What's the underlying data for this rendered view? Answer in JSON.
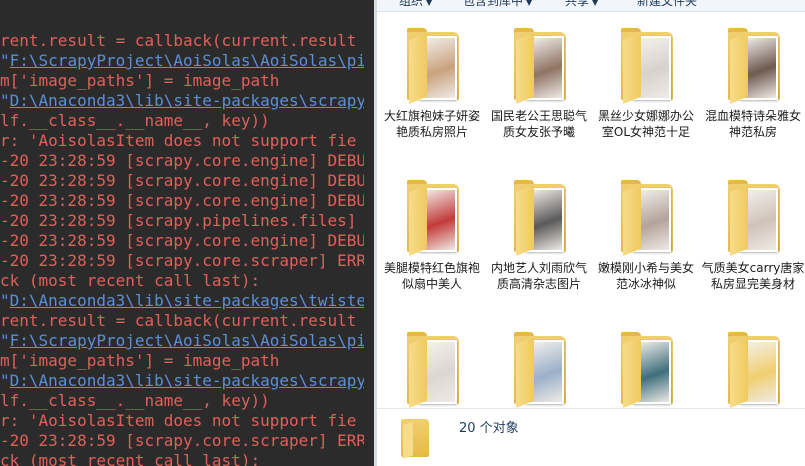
{
  "terminal": {
    "lines": [
      {
        "text": "rent.result = callback(current.result",
        "style": "red"
      },
      {
        "text": "\"F:\\ScrapyProject\\AoiSolas\\AoiSolas\\pi",
        "style": "link"
      },
      {
        "text": "m['image_paths'] = image_path",
        "style": "red"
      },
      {
        "text": "\"D:\\Anaconda3\\lib\\site-packages\\scrapy",
        "style": "link"
      },
      {
        "text": "lf.__class__.__name__, key))",
        "style": "red"
      },
      {
        "text": "r: 'AoisolasItem does not support fie",
        "style": "red"
      },
      {
        "text": "-20 23:28:59 [scrapy.core.engine] DEBU",
        "style": "red"
      },
      {
        "text": "-20 23:28:59 [scrapy.core.engine] DEBU",
        "style": "red"
      },
      {
        "text": "-20 23:28:59 [scrapy.core.engine] DEBU",
        "style": "red"
      },
      {
        "text": "-20 23:28:59 [scrapy.pipelines.files]",
        "style": "red"
      },
      {
        "text": "-20 23:28:59 [scrapy.core.engine] DEBU",
        "style": "red"
      },
      {
        "text": "-20 23:28:59 [scrapy.core.scraper] ERR",
        "style": "red"
      },
      {
        "text": "ck (most recent call last):",
        "style": "red"
      },
      {
        "text": "\"D:\\Anaconda3\\lib\\site-packages\\twiste",
        "style": "link"
      },
      {
        "text": "rent.result = callback(current.result",
        "style": "red"
      },
      {
        "text": "\"F:\\ScrapyProject\\AoiSolas\\AoiSolas\\pi",
        "style": "link"
      },
      {
        "text": "m['image_paths'] = image_path",
        "style": "red"
      },
      {
        "text": "\"D:\\Anaconda3\\lib\\site-packages\\scrapy",
        "style": "link"
      },
      {
        "text": "lf.__class__.__name__, key))",
        "style": "red"
      },
      {
        "text": "r: 'AoisolasItem does not support fie",
        "style": "red"
      },
      {
        "text": "-20 23:28:59 [scrapy.core.scraper] ERR",
        "style": "red"
      },
      {
        "text": "ck (most recent call last):",
        "style": "red"
      }
    ]
  },
  "toolbar": {
    "items": [
      {
        "label": "组织",
        "has_arrow": true
      },
      {
        "label": "包含到库中",
        "has_arrow": true
      },
      {
        "label": "共享",
        "has_arrow": true
      },
      {
        "label": "新建文件夹",
        "has_arrow": false
      }
    ]
  },
  "folders": [
    {
      "name": "大红旗袍妹子妍姿艳质私房照片",
      "photo": "#c9a27e"
    },
    {
      "name": "国民老公王思聪气质女友张予曦",
      "photo": "#8f7463"
    },
    {
      "name": "黑丝少女娜娜办公室OL女神范十足",
      "photo": "#d8d2cc"
    },
    {
      "name": "混血模特诗朵雅女神范私房",
      "photo": "#6e5a50"
    },
    {
      "name": "美腿模特红色旗袍似扇中美人",
      "photo": "#c23a3a"
    },
    {
      "name": "内地艺人刘雨欣气质高清杂志图片",
      "photo": "#5a5a5a"
    },
    {
      "name": "嫩模刚小希与美女范冰冰神似",
      "photo": "#b3a39a"
    },
    {
      "name": "气质美女carry唐家私房显完美身材",
      "photo": "#cfc3b8"
    },
    {
      "name": "",
      "photo": "#ddd6d0"
    },
    {
      "name": "",
      "photo": "#9ab0c8"
    },
    {
      "name": "",
      "photo": "#3e6f7a"
    },
    {
      "name": "",
      "photo": "#f0cf6f"
    }
  ],
  "status": {
    "count_text": "20 个对象"
  }
}
